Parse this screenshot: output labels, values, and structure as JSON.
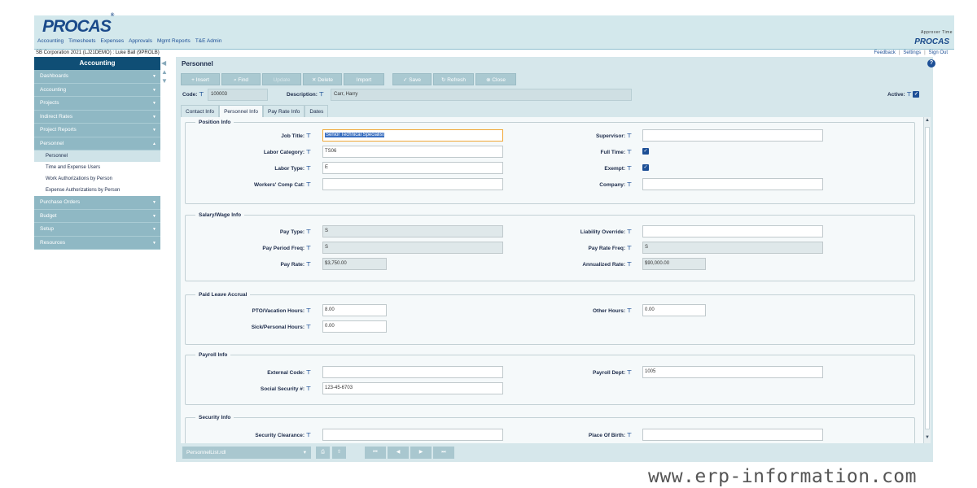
{
  "header": {
    "logo": "PROCAS",
    "approver": "Approver  Time",
    "logo_small": "PROCAS",
    "nav": [
      "Accounting",
      "Timesheets",
      "Expenses",
      "Approvals",
      "Mgmt Reports",
      "T&E Admin"
    ]
  },
  "subbar": {
    "context": "SB Corporation 2021 (LJ21DEMO) : Luke Ball (9PROLB)",
    "links": [
      "Feedback",
      "Settings",
      "Sign Out"
    ]
  },
  "sidebar": {
    "title": "Accounting",
    "items_top": [
      "Dashboards",
      "Accounting",
      "Projects",
      "Indirect Rates",
      "Project Reports",
      "Personnel"
    ],
    "subitems": [
      "Personnel",
      "Time and Expense Users",
      "Work Authorizations by Person",
      "Expense Authorizations by Person"
    ],
    "items_bottom": [
      "Purchase Orders",
      "Budget",
      "Setup",
      "Resources"
    ]
  },
  "main": {
    "title": "Personnel",
    "toolbar": [
      "+ Insert",
      "⌕ Find",
      "Update",
      "✕ Delete",
      "Import",
      "✓ Save",
      "↻ Refresh",
      "⊗ Close"
    ],
    "code_label": "Code:",
    "code_value": "100003",
    "description_label": "Description:",
    "description_value": "Carr, Harry",
    "active_label": "Active:",
    "tabs": [
      "Contact Info",
      "Personnel Info",
      "Pay Rate Info",
      "Dates"
    ]
  },
  "position_info": {
    "legend": "Position Info",
    "job_title_label": "Job Title:",
    "job_title": "Senior Technical Specialist",
    "labor_category_label": "Labor Category:",
    "labor_category": "TS06",
    "labor_type_label": "Labor Type:",
    "labor_type": "E",
    "workers_comp_label": "Workers' Comp Cat:",
    "workers_comp": "",
    "supervisor_label": "Supervisor:",
    "supervisor": "",
    "full_time_label": "Full Time:",
    "exempt_label": "Exempt:",
    "company_label": "Company:",
    "company": ""
  },
  "salary_info": {
    "legend": "Salary/Wage Info",
    "pay_type_label": "Pay Type:",
    "pay_type": "S",
    "pay_period_label": "Pay Period Freq:",
    "pay_period": "S",
    "pay_rate_label": "Pay Rate:",
    "pay_rate": "$3,750.00",
    "liability_label": "Liability Override:",
    "liability": "",
    "pay_rate_freq_label": "Pay Rate Freq:",
    "pay_rate_freq": "S",
    "annualized_label": "Annualized Rate:",
    "annualized": "$90,000.00"
  },
  "leave_info": {
    "legend": "Paid Leave Accrual",
    "pto_label": "PTO/Vacation Hours:",
    "pto": "8.00",
    "sick_label": "Sick/Personal Hours:",
    "sick": "0.00",
    "other_label": "Other Hours:",
    "other": "0.00"
  },
  "payroll_info": {
    "legend": "Payroll Info",
    "external_label": "External Code:",
    "external": "",
    "ssn_label": "Social Security #:",
    "ssn": "123-45-6703",
    "dept_label": "Payroll Dept:",
    "dept": "1005"
  },
  "security_info": {
    "legend": "Security Info",
    "clearance_label": "Security Clearance:",
    "clearance": "",
    "birth_label": "Place Of Birth:",
    "birth": ""
  },
  "bottom": {
    "report": "PersonnelList.rdl"
  },
  "watermark": "www.erp-information.com"
}
